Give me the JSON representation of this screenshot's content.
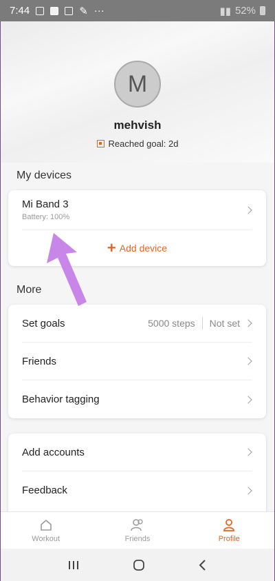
{
  "status_bar": {
    "time": "7:44",
    "more": "···",
    "battery": "52%"
  },
  "profile": {
    "avatar_letter": "M",
    "username": "mehvish",
    "goal_text": "Reached goal: 2d"
  },
  "devices": {
    "title": "My devices",
    "device_name": "Mi Band 3",
    "battery": "Battery: 100%",
    "add_label": "Add device"
  },
  "more": {
    "title": "More",
    "items": [
      {
        "label": "Set goals",
        "value": "5000 steps",
        "extra": "Not set"
      },
      {
        "label": "Friends"
      },
      {
        "label": "Behavior tagging"
      }
    ]
  },
  "accounts": {
    "items": [
      {
        "label": "Add accounts"
      },
      {
        "label": "Feedback"
      }
    ]
  },
  "tabs": [
    {
      "label": "Workout",
      "icon": "home-icon"
    },
    {
      "label": "Friends",
      "icon": "friends-icon"
    },
    {
      "label": "Profile",
      "icon": "person-icon"
    }
  ],
  "colors": {
    "accent": "#e8641d",
    "annotation_arrow": "#c887e8"
  }
}
